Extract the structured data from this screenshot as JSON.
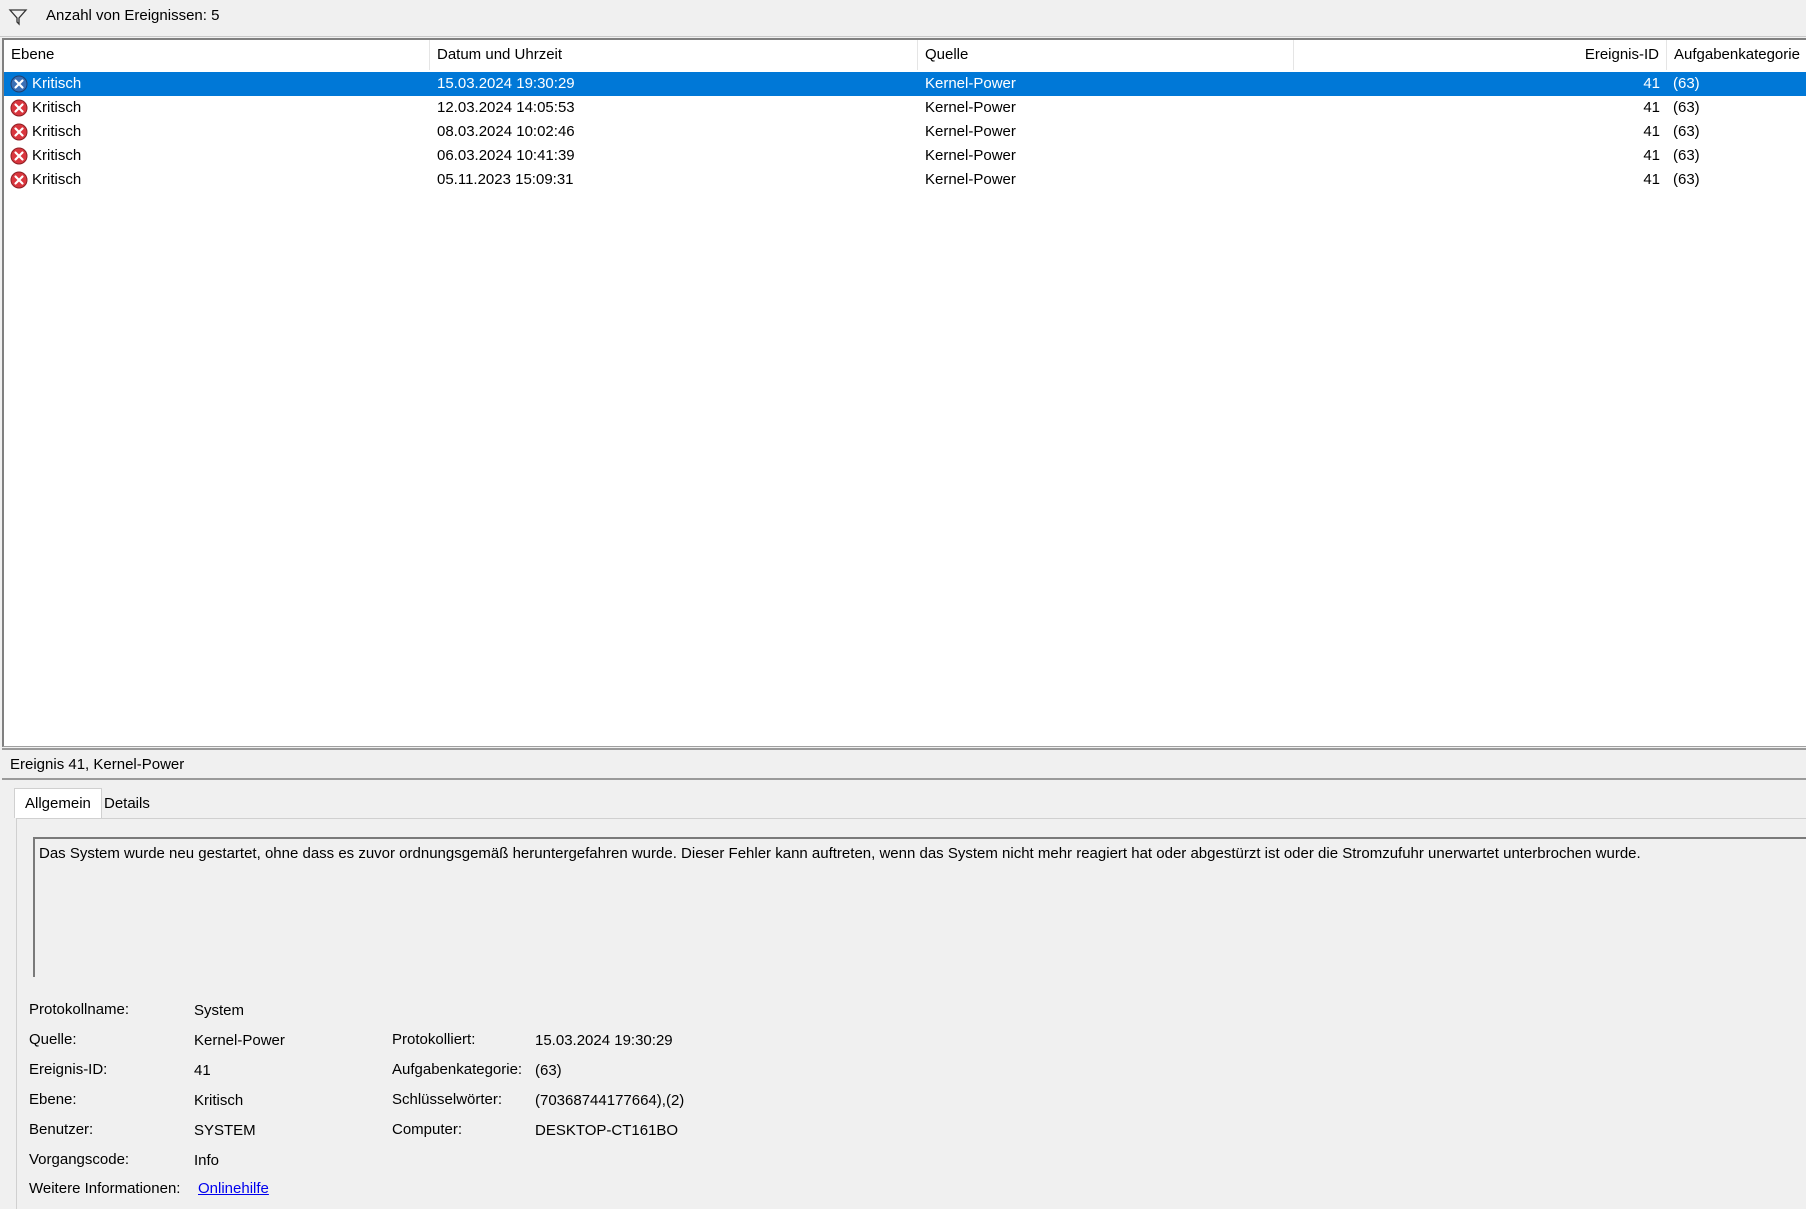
{
  "filterbar": {
    "icon": "filter-icon",
    "text": "Anzahl von Ereignissen: 5"
  },
  "list": {
    "columns": [
      "Ebene",
      "Datum und Uhrzeit",
      "Quelle",
      "Ereignis-ID",
      "Aufgabenkategorie"
    ],
    "rows": [
      {
        "level": "Kritisch",
        "datetime": "15.03.2024 19:30:29",
        "source": "Kernel-Power",
        "id": "41",
        "category": "(63)",
        "selected": true
      },
      {
        "level": "Kritisch",
        "datetime": "12.03.2024 14:05:53",
        "source": "Kernel-Power",
        "id": "41",
        "category": "(63)",
        "selected": false
      },
      {
        "level": "Kritisch",
        "datetime": "08.03.2024 10:02:46",
        "source": "Kernel-Power",
        "id": "41",
        "category": "(63)",
        "selected": false
      },
      {
        "level": "Kritisch",
        "datetime": "06.03.2024 10:41:39",
        "source": "Kernel-Power",
        "id": "41",
        "category": "(63)",
        "selected": false
      },
      {
        "level": "Kritisch",
        "datetime": "05.11.2023 15:09:31",
        "source": "Kernel-Power",
        "id": "41",
        "category": "(63)",
        "selected": false
      }
    ],
    "level_icon": "critical-error-icon",
    "selection_color": "#0078d7",
    "error_color": "#d9363e"
  },
  "detail": {
    "title": "Ereignis 41, Kernel-Power",
    "tabs": [
      "Allgemein",
      "Details"
    ],
    "message": "Das System wurde neu gestartet, ohne dass es zuvor ordnungsgemäß heruntergefahren wurde. Dieser Fehler kann auftreten, wenn das System nicht mehr reagiert hat oder abgestürzt ist oder die Stromzufuhr unerwartet unterbrochen wurde.",
    "props": {
      "log_name_label": "Protokollname:",
      "log_name": "System",
      "source_label": "Quelle:",
      "source": "Kernel-Power",
      "event_id_label": "Ereignis-ID:",
      "event_id": "41",
      "level_label": "Ebene:",
      "level": "Kritisch",
      "user_label": "Benutzer:",
      "user": "SYSTEM",
      "opcode_label": "Vorgangscode:",
      "opcode": "Info",
      "more_info_label": "Weitere Informationen:",
      "more_info_link": "Onlinehilfe",
      "logged_label": "Protokolliert:",
      "logged": "15.03.2024 19:30:29",
      "task_category_label": "Aufgabenkategorie:",
      "task_category": "(63)",
      "keywords_label": "Schlüsselwörter:",
      "keywords": "(70368744177664),(2)",
      "computer_label": "Computer:",
      "computer": "DESKTOP-CT161BO"
    }
  }
}
